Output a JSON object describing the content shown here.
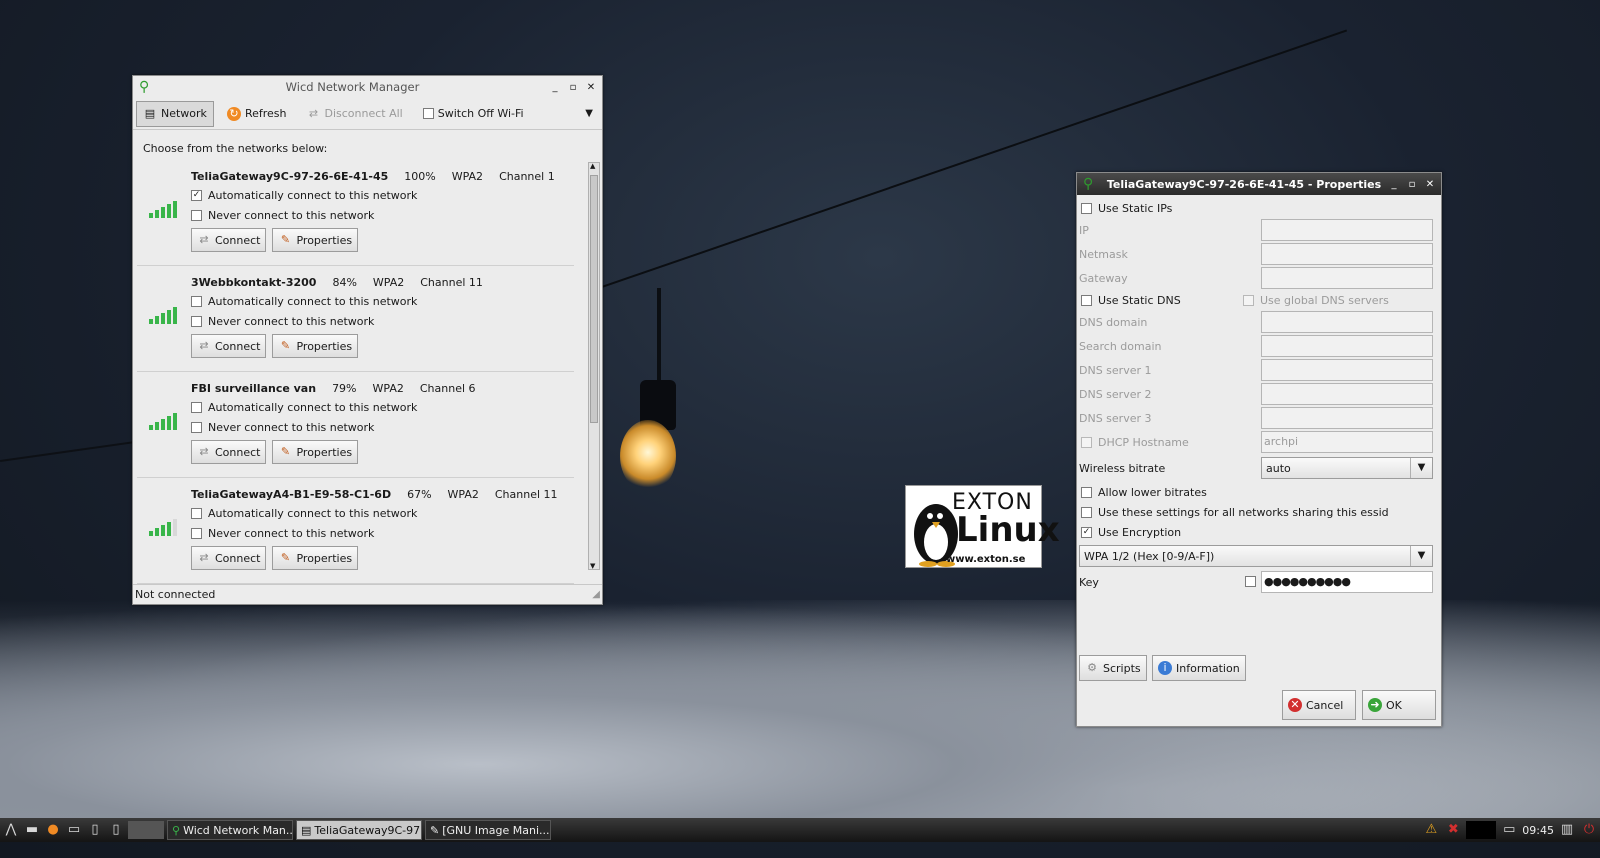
{
  "wicd": {
    "title": "Wicd Network Manager",
    "toolbar": {
      "network": "Network",
      "refresh": "Refresh",
      "disconnect_all": "Disconnect All",
      "switch_off": "Switch Off Wi-Fi"
    },
    "choose_label": "Choose from the networks below:",
    "networks": [
      {
        "ssid": "TeliaGateway9C-97-26-6E-41-45",
        "strength": "100%",
        "enc": "WPA2",
        "channel": "Channel 1",
        "auto": true,
        "never": false
      },
      {
        "ssid": "3Webbkontakt-3200",
        "strength": "84%",
        "enc": "WPA2",
        "channel": "Channel 11",
        "auto": false,
        "never": false
      },
      {
        "ssid": "FBI surveillance van",
        "strength": "79%",
        "enc": "WPA2",
        "channel": "Channel 6",
        "auto": false,
        "never": false
      },
      {
        "ssid": "TeliaGatewayA4-B1-E9-58-C1-6D",
        "strength": "67%",
        "enc": "WPA2",
        "channel": "Channel 11",
        "auto": false,
        "never": false
      }
    ],
    "auto_label": "Automatically connect to this network",
    "never_label": "Never connect to this network",
    "connect": "Connect",
    "properties": "Properties",
    "status": "Not connected"
  },
  "props": {
    "title": "TeliaGateway9C-97-26-6E-41-45 - Properties",
    "use_static_ips": "Use Static IPs",
    "ip": "IP",
    "netmask": "Netmask",
    "gateway": "Gateway",
    "use_static_dns": "Use Static DNS",
    "use_global_dns": "Use global DNS servers",
    "dns_domain": "DNS domain",
    "search_domain": "Search domain",
    "dns1": "DNS server 1",
    "dns2": "DNS server 2",
    "dns3": "DNS server 3",
    "dhcp_hostname": "DHCP Hostname",
    "dhcp_value": "archpi",
    "wireless_bitrate": "Wireless bitrate",
    "bitrate_value": "auto",
    "allow_lower": "Allow lower bitrates",
    "use_settings": "Use these settings for all networks sharing this essid",
    "use_encryption": "Use Encryption",
    "encryption_value": "WPA 1/2 (Hex [0-9/A-F])",
    "key": "Key",
    "key_value": "●●●●●●●●●●",
    "scripts": "Scripts",
    "information": "Information",
    "cancel": "Cancel",
    "ok": "OK"
  },
  "logo": {
    "line1": "EXTON",
    "line2": "Linux",
    "url": "www.exton.se"
  },
  "taskbar": {
    "tasks": [
      "Wicd Network Man...",
      "TeliaGateway9C-97...",
      "[GNU Image Mani..."
    ],
    "clock": "09:45"
  },
  "colors": {
    "signal": "#39b54a",
    "cancel": "#d22f2f",
    "ok": "#3aa53a"
  }
}
